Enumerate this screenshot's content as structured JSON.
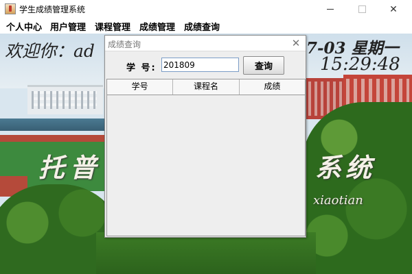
{
  "window": {
    "title": "学生成绩管理系统"
  },
  "menu": [
    {
      "label": "个人中心"
    },
    {
      "label": "用户管理"
    },
    {
      "label": "课程管理"
    },
    {
      "label": "成绩管理"
    },
    {
      "label": "成绩查询"
    }
  ],
  "background": {
    "welcome": "欢迎你：ad",
    "date": "7-03 星期一",
    "time": "15:29:48",
    "system_title_left": "托普",
    "system_title_right": "系统",
    "subtitle": "xiaotian"
  },
  "dialog": {
    "title": "成绩查询",
    "student_id_label": "学  号:",
    "student_id_value": "201809",
    "query_button": "查询",
    "table": {
      "columns": [
        "学号",
        "课程名",
        "成绩"
      ],
      "rows": []
    }
  }
}
